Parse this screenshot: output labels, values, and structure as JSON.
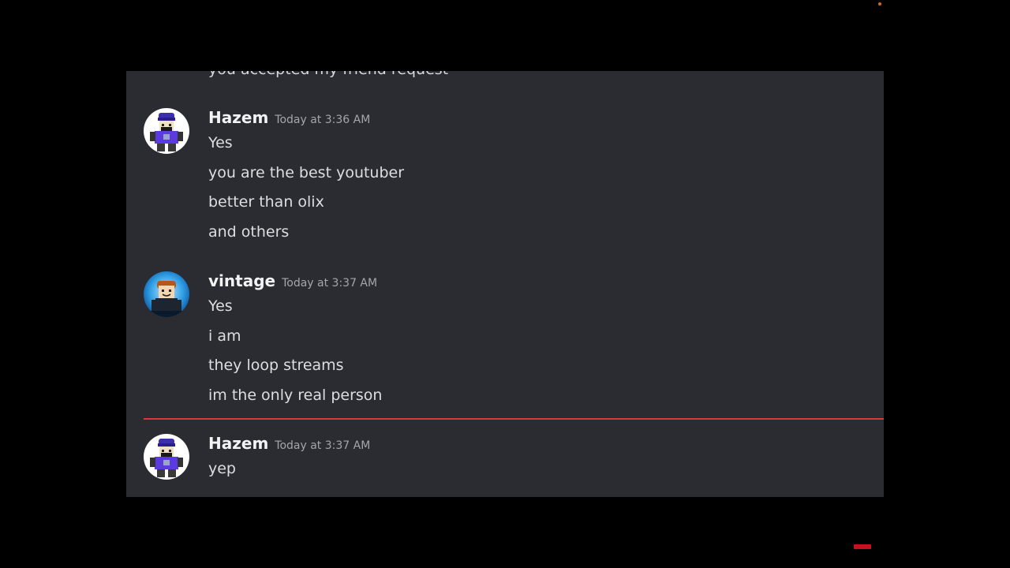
{
  "partial_message": "you accepted my friend request",
  "groups": [
    {
      "username": "Hazem",
      "timestamp": "Today at 3:36 AM",
      "lines": [
        "Yes",
        "you are the best youtuber",
        "better than olix",
        "and others"
      ]
    },
    {
      "username": "vintage",
      "timestamp": "Today at 3:37 AM",
      "lines": [
        "Yes",
        "i am",
        "they loop streams",
        "im the only real person"
      ]
    },
    {
      "username": "Hazem",
      "timestamp": "Today at 3:37 AM",
      "lines": [
        "yep"
      ]
    }
  ],
  "colors": {
    "chat_background": "#2a2c31",
    "new_messages_divider": "#e0343c",
    "username": "#f2f3f5",
    "timestamp": "#a3a6aa",
    "message_text": "#dcdee1"
  }
}
